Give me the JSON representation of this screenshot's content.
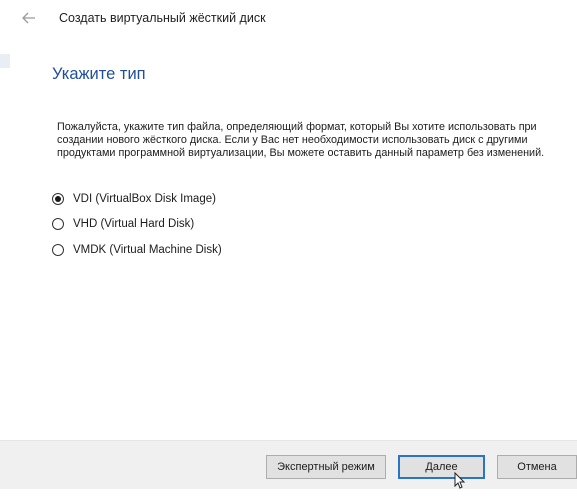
{
  "window": {
    "title": "Создать виртуальный жёсткий диск",
    "back_icon": "arrow-left-icon"
  },
  "page": {
    "heading": "Укажите тип",
    "description": "Пожалуйста, укажите тип файла, определяющий формат, который Вы хотите использовать при создании нового жёсткого диска. Если у Вас нет необходимости использовать диск с другими продуктами программной виртуализации, Вы можете оставить данный параметр без изменений."
  },
  "options": [
    {
      "label": "VDI (VirtualBox Disk Image)",
      "checked": true
    },
    {
      "label": "VHD (Virtual Hard Disk)",
      "checked": false
    },
    {
      "label": "VMDK (Virtual Machine Disk)",
      "checked": false
    }
  ],
  "footer": {
    "expert_label": "Экспертный режим",
    "next_label": "Далее",
    "cancel_label": "Отмена"
  },
  "colors": {
    "heading": "#1e4fa0",
    "primary_border": "#2a73c9",
    "footer_bg": "#f0f0f0"
  }
}
